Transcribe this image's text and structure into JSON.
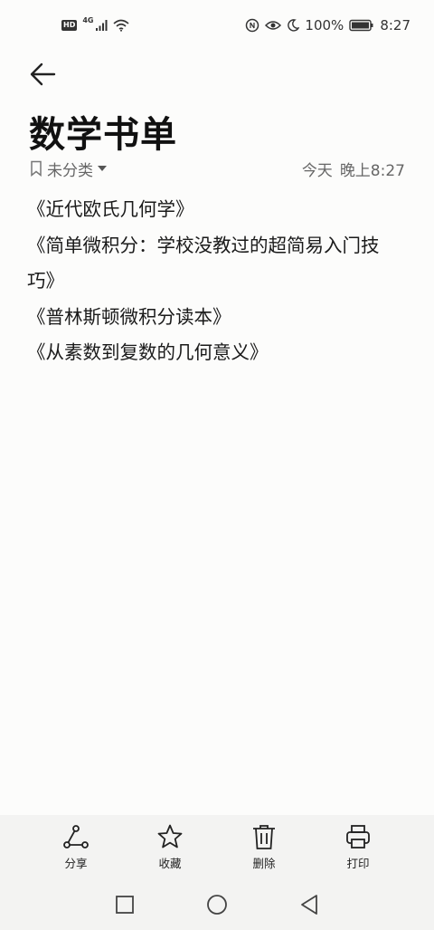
{
  "status_bar": {
    "hd": "HD",
    "network": "4G",
    "battery_pct": "100%",
    "time": "8:27",
    "icons": [
      "signal-icon",
      "wifi-icon",
      "nfc-icon",
      "eye-comfort-icon",
      "moon-icon",
      "battery-icon"
    ]
  },
  "header": {
    "title": "数学书单"
  },
  "meta": {
    "category": "未分类",
    "date": "今天",
    "time": "晚上8:27"
  },
  "content": {
    "lines": [
      "《近代欧氏几何学》",
      "《简单微积分：学校没教过的超简易入门技巧》",
      "《普林斯顿微积分读本》",
      "《从素数到复数的几何意义》"
    ]
  },
  "actions": {
    "share": "分享",
    "favorite": "收藏",
    "delete": "删除",
    "print": "打印"
  },
  "colors": {
    "background": "#fcfcfb",
    "bar_background": "#f3f3f2",
    "text": "#1a1a1a",
    "meta_text": "#666666"
  }
}
